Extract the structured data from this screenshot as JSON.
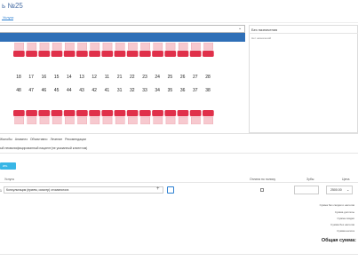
{
  "header": {
    "title": "ь №25",
    "tab": "Услуги"
  },
  "right_panel": {
    "title": "Без назначения",
    "subtitle": "Нет назначений"
  },
  "teeth": {
    "upper_numbers": [
      "18",
      "17",
      "16",
      "15",
      "14",
      "13",
      "12",
      "11",
      "21",
      "22",
      "23",
      "24",
      "25",
      "26",
      "27",
      "28"
    ],
    "lower_numbers": [
      "48",
      "47",
      "46",
      "45",
      "44",
      "43",
      "42",
      "41",
      "31",
      "32",
      "33",
      "34",
      "35",
      "36",
      "37",
      "38"
    ]
  },
  "subtabs": [
    "Жалобы",
    "Анамнез",
    "Объективно",
    "Лечение",
    "Рекомендации"
  ],
  "description": "ый неквалифицированный пациент(не указанный клиентом)",
  "add_button": "ить Услуги",
  "table": {
    "headers": {
      "service": "Услуга",
      "pay": "Оплата по полису",
      "teeth": "Зубы",
      "price": "Цена"
    },
    "row": {
      "index": "1",
      "service": "Консультация (прием, осмотр) стоматолога",
      "price": "2500.00"
    }
  },
  "summary": {
    "lines": [
      "Сумма без скидки и налогов",
      "Сумма доплаты",
      "Сумма скидки",
      "Сумма без налогов",
      "Сумма налога"
    ],
    "total_label": "Общая сумма:"
  },
  "colors": {
    "accent": "#2f6fb7",
    "button": "#38b6e6",
    "tooth": "#e0304a"
  }
}
